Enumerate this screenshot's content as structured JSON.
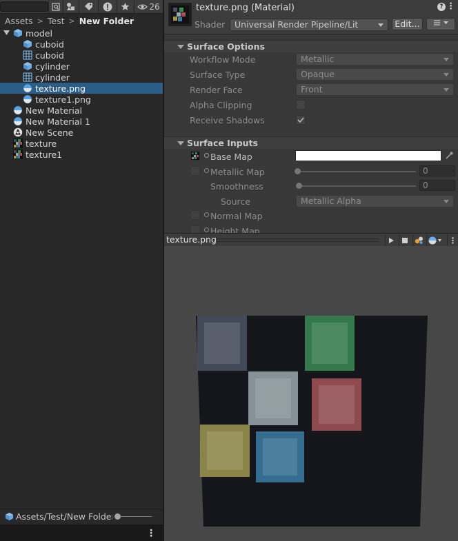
{
  "project": {
    "toolbar": {
      "hidden_count": "26"
    },
    "breadcrumb": [
      "Assets",
      "Test",
      "New Folder"
    ],
    "tree": [
      {
        "label": "model",
        "depth": 0,
        "icon": "model-prefab-icon",
        "expanded": true
      },
      {
        "label": "cuboid",
        "depth": 1,
        "icon": "mesh-prefab-icon"
      },
      {
        "label": "cuboid",
        "depth": 1,
        "icon": "mesh-grid-icon"
      },
      {
        "label": "cylinder",
        "depth": 1,
        "icon": "mesh-prefab-icon"
      },
      {
        "label": "cylinder",
        "depth": 1,
        "icon": "mesh-grid-icon"
      },
      {
        "label": "texture.png",
        "depth": 1,
        "icon": "material-sphere-icon",
        "selected": true
      },
      {
        "label": "texture1.png",
        "depth": 1,
        "icon": "material-sphere-icon"
      },
      {
        "label": "New Material",
        "depth": 0,
        "icon": "material-sphere-icon"
      },
      {
        "label": "New Material 1",
        "depth": 0,
        "icon": "material-sphere-icon"
      },
      {
        "label": "New Scene",
        "depth": 0,
        "icon": "scene-icon"
      },
      {
        "label": "texture",
        "depth": 0,
        "icon": "texture-icon"
      },
      {
        "label": "texture1",
        "depth": 0,
        "icon": "texture-icon"
      }
    ],
    "footer_path": "Assets/Test/New Folder/",
    "colors": {
      "selection": "#2c5d87"
    }
  },
  "inspector": {
    "title": "texture.png (Material)",
    "shader_label": "Shader",
    "shader_value": "Universal Render Pipeline/Lit",
    "edit_label": "Edit...",
    "surface_options": {
      "heading": "Surface Options",
      "props": [
        {
          "label": "Workflow Mode",
          "value": "Metallic"
        },
        {
          "label": "Surface Type",
          "value": "Opaque"
        },
        {
          "label": "Render Face",
          "value": "Front"
        }
      ],
      "alpha_clipping": {
        "label": "Alpha Clipping",
        "checked": false
      },
      "receive_shadows": {
        "label": "Receive Shadows",
        "checked": true
      }
    },
    "surface_inputs": {
      "heading": "Surface Inputs",
      "base_map": "Base Map",
      "metallic_map": "Metallic Map",
      "metallic_value": "0",
      "smoothness": "Smoothness",
      "smoothness_value": "0",
      "source": "Source",
      "source_value": "Metallic Alpha",
      "normal_map": "Normal Map",
      "height_map": "Height Map"
    }
  },
  "preview": {
    "title": "texture.png",
    "texture_squares": [
      {
        "color": "#4a5264"
      },
      {
        "color": "#3a8a55"
      },
      {
        "color": "#9aa8ae"
      },
      {
        "color": "#a45458"
      },
      {
        "color": "#a09850"
      },
      {
        "color": "#3a7ca4"
      }
    ]
  }
}
